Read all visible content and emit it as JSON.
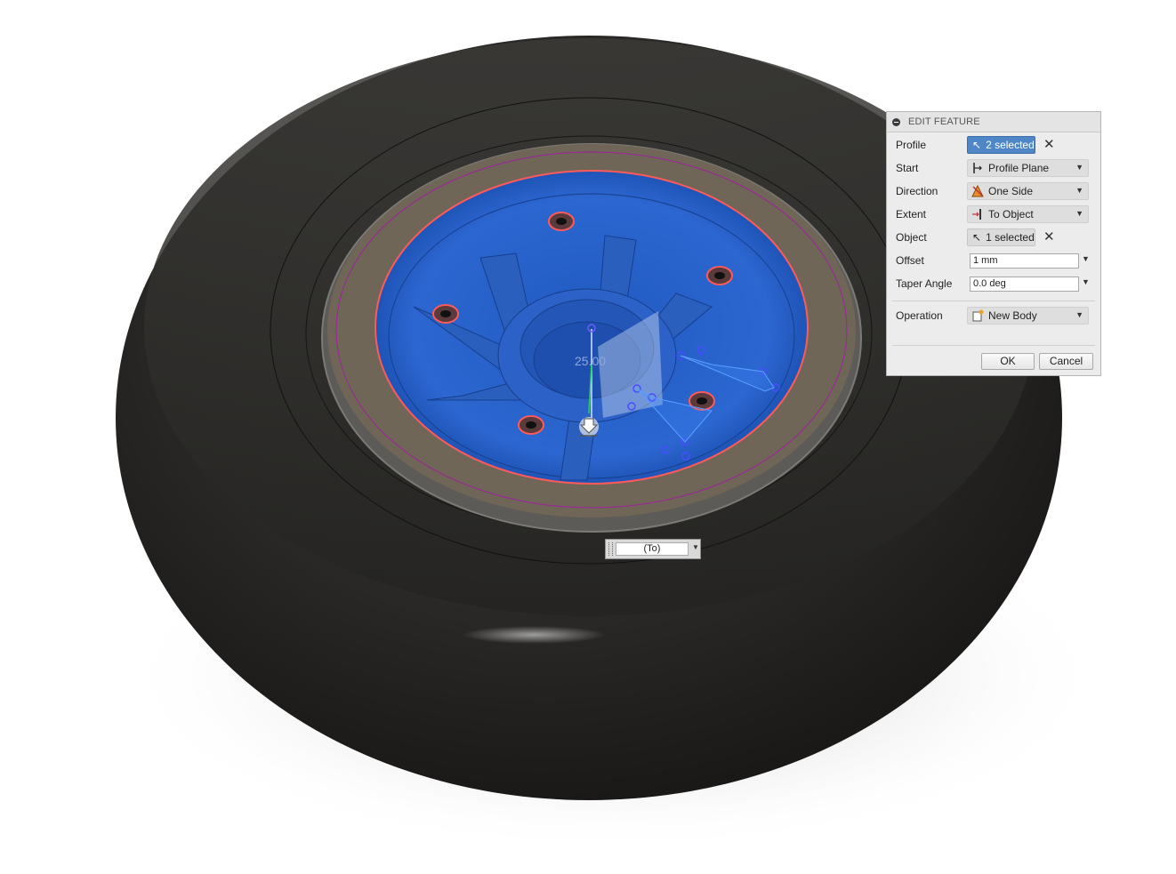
{
  "viewport": {
    "dimension_value": "25.00",
    "extent_dropdown_value": "(To)"
  },
  "dialog": {
    "title": "EDIT FEATURE",
    "profile": {
      "label": "Profile",
      "value": "2 selected"
    },
    "start": {
      "label": "Start",
      "value": "Profile Plane"
    },
    "direction": {
      "label": "Direction",
      "value": "One Side"
    },
    "extent": {
      "label": "Extent",
      "value": "To Object"
    },
    "object": {
      "label": "Object",
      "value": "1 selected"
    },
    "offset": {
      "label": "Offset",
      "value": "1 mm"
    },
    "taper_angle": {
      "label": "Taper Angle",
      "value": "0.0 deg"
    },
    "operation": {
      "label": "Operation",
      "value": "New Body"
    },
    "ok_label": "OK",
    "cancel_label": "Cancel"
  },
  "colors": {
    "accent_blue": "#4f86c6",
    "wheel_blue": "#2a5fc4",
    "tire": "#2b2a28",
    "rim_ring": "#6e6455",
    "selection_red": "#ff5a5a",
    "sketch_magenta": "#a020a0"
  }
}
